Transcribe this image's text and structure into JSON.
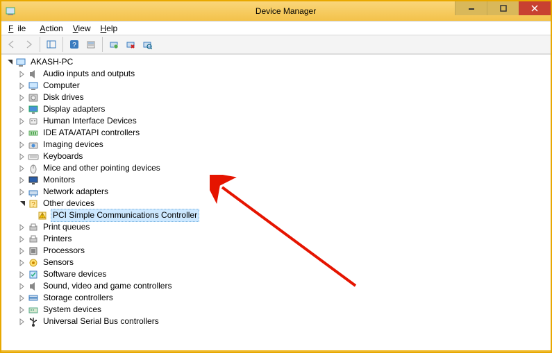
{
  "window": {
    "title": "Device Manager"
  },
  "menu": {
    "file": "File",
    "action": "Action",
    "view": "View",
    "help": "Help"
  },
  "tree": {
    "root": "AKASH-PC",
    "categories": [
      {
        "label": "Audio inputs and outputs",
        "icon": "speaker",
        "expanded": false
      },
      {
        "label": "Computer",
        "icon": "computer",
        "expanded": false
      },
      {
        "label": "Disk drives",
        "icon": "disk",
        "expanded": false
      },
      {
        "label": "Display adapters",
        "icon": "display",
        "expanded": false
      },
      {
        "label": "Human Interface Devices",
        "icon": "hid",
        "expanded": false
      },
      {
        "label": "IDE ATA/ATAPI controllers",
        "icon": "ide",
        "expanded": false
      },
      {
        "label": "Imaging devices",
        "icon": "camera",
        "expanded": false
      },
      {
        "label": "Keyboards",
        "icon": "keyboard",
        "expanded": false
      },
      {
        "label": "Mice and other pointing devices",
        "icon": "mouse",
        "expanded": false
      },
      {
        "label": "Monitors",
        "icon": "monitor",
        "expanded": false
      },
      {
        "label": "Network adapters",
        "icon": "network",
        "expanded": false
      },
      {
        "label": "Other devices",
        "icon": "other",
        "expanded": true,
        "children": [
          {
            "label": "PCI Simple Communications Controller",
            "icon": "warning",
            "selected": true
          }
        ]
      },
      {
        "label": "Print queues",
        "icon": "printer",
        "expanded": false
      },
      {
        "label": "Printers",
        "icon": "printer",
        "expanded": false
      },
      {
        "label": "Processors",
        "icon": "cpu",
        "expanded": false
      },
      {
        "label": "Sensors",
        "icon": "sensor",
        "expanded": false
      },
      {
        "label": "Software devices",
        "icon": "software",
        "expanded": false
      },
      {
        "label": "Sound, video and game controllers",
        "icon": "speaker",
        "expanded": false
      },
      {
        "label": "Storage controllers",
        "icon": "storage",
        "expanded": false
      },
      {
        "label": "System devices",
        "icon": "system",
        "expanded": false
      },
      {
        "label": "Universal Serial Bus controllers",
        "icon": "usb",
        "expanded": false
      }
    ]
  }
}
